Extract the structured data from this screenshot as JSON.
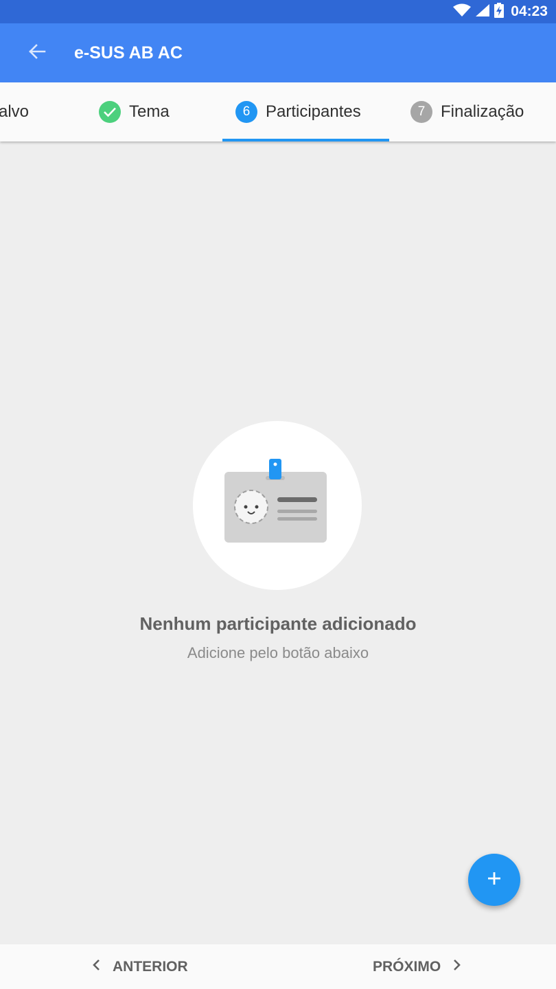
{
  "status_bar": {
    "time": "04:23",
    "icons": [
      "wifi-icon",
      "signal-icon",
      "battery-charging-icon"
    ]
  },
  "app_bar": {
    "title": "e-SUS AB AC",
    "back_icon": "arrow-left-icon"
  },
  "stepper": {
    "steps": [
      {
        "label": "alvo",
        "badge": "",
        "state": "done-partial"
      },
      {
        "label": "Tema",
        "badge": "check-icon",
        "state": "done"
      },
      {
        "label": "Participantes",
        "badge": "6",
        "state": "active"
      },
      {
        "label": "Finalização",
        "badge": "7",
        "state": "pending"
      }
    ],
    "colors": {
      "done": "#4cd07d",
      "active": "#2196f3",
      "pending": "#9e9e9e"
    }
  },
  "empty_state": {
    "illustration_icon": "id-badge-icon",
    "title": "Nenhum participante adicionado",
    "subtitle": "Adicione pelo botão abaixo"
  },
  "fab": {
    "icon": "plus-icon",
    "color": "#2196f3"
  },
  "bottom_nav": {
    "previous_label": "ANTERIOR",
    "next_label": "PRÓXIMO"
  }
}
